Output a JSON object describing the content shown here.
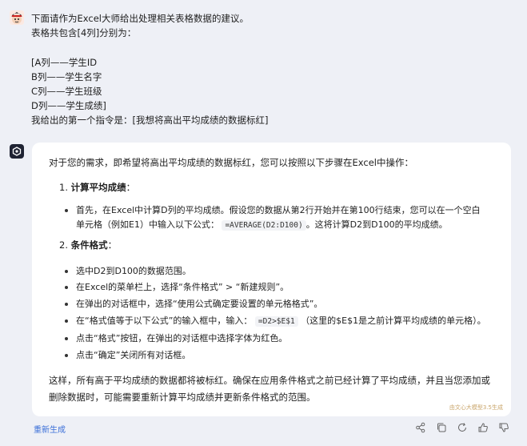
{
  "user": {
    "lines": [
      "下面请作为Excel大师给出处理相关表格数据的建议。",
      "表格共包含[4列]分别为：",
      "",
      "[A列——学生ID",
      "B列——学生名字",
      "C列——学生班级",
      "D列——学生成绩]",
      "我给出的第一个指令是：[我想将高出平均成绩的数据标红]"
    ]
  },
  "answer": {
    "intro": "对于您的需求，即希望将高出平均成绩的数据标红，您可以按照以下步骤在Excel中操作：",
    "step1_num": "1.",
    "step1_title": "计算平均成绩",
    "step1_colon": "：",
    "step1_b1_a": "首先，在Excel中计算D列的平均成绩。假设您的数据从第2行开始并在第100行结束，您可以在一个空白",
    "step1_b1_b": "单元格（例如E1）中输入以下公式：",
    "step1_code": "=AVERAGE(D2:D100)",
    "step1_b1_c": "。这将计算D2到D100的平均成绩。",
    "step2_num": "2.",
    "step2_title": "条件格式",
    "step2_colon": "：",
    "step2_bullets": [
      "选中D2到D100的数据范围。",
      "在Excel的菜单栏上，选择“条件格式” > “新建规则”。",
      "在弹出的对话框中，选择“使用公式确定要设置的单元格格式”。"
    ],
    "step2_b4_a": "在“格式值等于以下公式”的输入框中，输入：",
    "step2_code": "=D2>$E$1",
    "step2_b4_b": "（这里的$E$1是之前计算平均成绩的单元格）。",
    "step2_bullets_2": [
      "点击“格式”按钮，在弹出的对话框中选择字体为红色。",
      "点击“确定”关闭所有对话框。"
    ],
    "outro": "这样，所有高于平均成绩的数据都将被标红。确保在应用条件格式之前已经计算了平均成绩，并且当您添加或删除数据时，可能需要重新计算平均成绩并更新条件格式的范围。",
    "watermark": "由文心大模型3.5生成"
  },
  "footer": {
    "regenerate_label": "重新生成"
  },
  "icons": [
    "share-icon",
    "copy-icon",
    "refresh-icon",
    "thumbs-up-icon",
    "thumbs-down-icon"
  ]
}
